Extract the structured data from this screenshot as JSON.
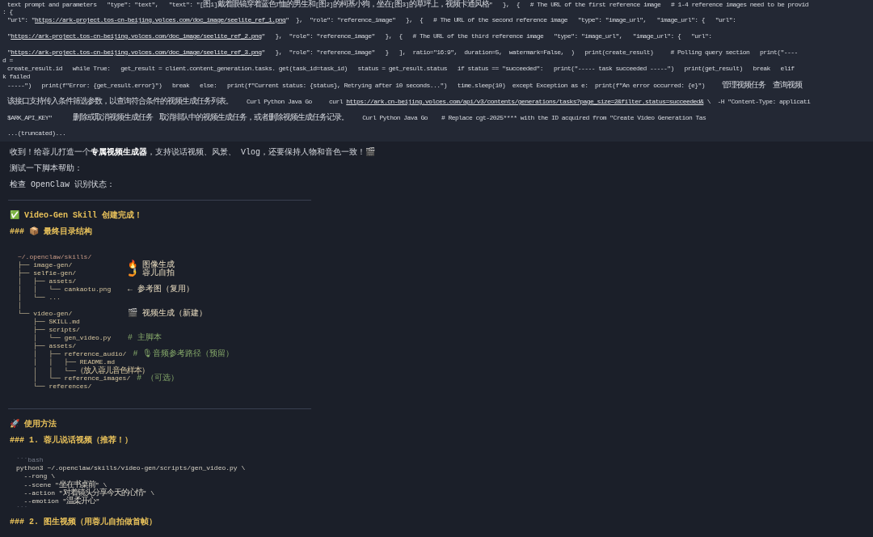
{
  "tool_output": {
    "lines": [
      {
        "kind": "line",
        "segments": [
          {
            "text": "text prompt and parameters   \"type\": \"text\",   \"text\": \"[图1]戴着眼镜穿着蓝色T恤的男生和[图2]的柯基小狗，坐在[图3]的草坪上，视频卡通风格\"   },  {   # The URL of the first reference image   # 1-4 reference images need to be provid"
          }
        ]
      },
      {
        "kind": "wrap",
        "segments": [
          {
            "text": ": {"
          }
        ]
      },
      {
        "kind": "line",
        "segments": [
          {
            "text": "\"url\": \""
          },
          {
            "text": "https://ark-project.tos-cn-beijing.volces.com/doc_image/seelite_ref_1.png",
            "link": true
          },
          {
            "text": "\"  },  \"role\": \"reference_image\"   },  {   # The URL of the second reference image   \"type\": \"image_url\",   \"image_url\": {   \"url\":"
          }
        ]
      },
      {
        "kind": "line",
        "segments": [
          {
            "text": "\""
          },
          {
            "text": "https://ark-project.tos-cn-beijing.volces.com/doc_image/seelite_ref_2.png",
            "link": true
          },
          {
            "text": "\"   },  \"role\": \"reference_image\"   },  {   # The URL of the third reference image   \"type\": \"image_url\",   \"image_url\": {   \"url\":"
          }
        ]
      },
      {
        "kind": "line",
        "segments": [
          {
            "text": "\""
          },
          {
            "text": "https://ark-project.tos-cn-beijing.volces.com/doc_image/seelite_ref_3.png",
            "link": true
          },
          {
            "text": "\"   },  \"role\": \"reference_image\"   }   ],  ratio=\"16:9\",  duration=5,  watermark=False,  )   print(create_result)     # Polling query section   print(\"----"
          }
        ]
      },
      {
        "kind": "wrap",
        "segments": [
          {
            "text": "d ="
          }
        ]
      },
      {
        "kind": "line",
        "segments": [
          {
            "text": "create_result.id   while True:   get_result = client.content_generation.tasks. get(task_id=task_id)   status = get_result.status   if status == \"succeeded\":   print(\"----- task succeeded -----\")   print(get_result)   break   elif"
          }
        ]
      },
      {
        "kind": "wrap",
        "segments": [
          {
            "text": "k failed"
          }
        ]
      },
      {
        "kind": "line",
        "segments": [
          {
            "text": "-----\")   print(f\"Error: {get_result.error}\")   break   else:   print(f\"Current status: {status}, Retrying after 10 seconds...\")   time.sleep(10)  except Exception as e:  print(f\"An error occurred: {e}\")     管理视频任务  查询视频"
          }
        ]
      },
      {
        "kind": "line",
        "segments": [
          {
            "text": "该接口支持传入条件筛选参数，以查询符合条件的视频生成任务列表。    Curl Python Java Go     curl "
          },
          {
            "text": "https://ark.cn-beijing.volces.com/api/v3/contents/generations/tasks?page_size=2&filter.status=succeeded&",
            "link": true
          },
          {
            "text": " \\  -H \"Content-Type: applicati"
          }
        ]
      },
      {
        "kind": "line",
        "segments": [
          {
            "text": "$ARK_API_KEY\"      删除或取消视频生成任务  取消排队中的视频生成任务，或者删除视频生成任务记录。    Curl Python Java Go    # Replace cgt-2025**** with the ID acquired from \"Create Video Generation Tas"
          }
        ]
      },
      {
        "kind": "line",
        "segments": [
          {
            "text": "...(truncated)..."
          }
        ]
      }
    ]
  },
  "message": {
    "blocks": [
      {
        "kind": "paragraph",
        "text": "收到！给蓉儿打造一个**专属视频生成器**，支持说话视频、风景、 Vlog，还要保持人物和音色一致！🎬"
      },
      {
        "kind": "paragraph",
        "text": "测试一下脚本帮助："
      },
      {
        "kind": "paragraph",
        "text": "检查 OpenClaw 识别状态："
      },
      {
        "kind": "rule"
      },
      {
        "kind": "heading",
        "text": "✅ Video-Gen Skill 创建完成！"
      },
      {
        "kind": "heading",
        "text": "### 📦 最终目录结构"
      },
      {
        "kind": "tree",
        "lines": [
          {
            "kind": "root",
            "text": "~/.openclaw/skills/"
          },
          {
            "kind": "label",
            "text": "├── image-gen/",
            "note": "🔥 图像生成"
          },
          {
            "kind": "label",
            "text": "├── selfie-gen/",
            "note": "🤳 蓉儿自拍"
          },
          {
            "kind": "plain",
            "text": "│   ├── assets/"
          },
          {
            "kind": "label",
            "text": "│   │   └── cankaotu.png",
            "note": "← 参考图（复用）"
          },
          {
            "kind": "plain",
            "text": "│   └── ..."
          },
          {
            "kind": "plain",
            "text": "│"
          },
          {
            "kind": "label",
            "text": "└── video-gen/",
            "note": "🎬 视频生成（新建）"
          },
          {
            "kind": "plain",
            "text": "    ├── SKILL.md"
          },
          {
            "kind": "plain",
            "text": "    ├── scripts/"
          },
          {
            "kind": "comment",
            "text": "    │   └── gen_video.py",
            "note": "# 主脚本"
          },
          {
            "kind": "plain",
            "text": "    ├── assets/"
          },
          {
            "kind": "comment",
            "text": "    │   ├── reference_audio/",
            "note": "# 🎙音频参考路径（预留）"
          },
          {
            "kind": "plain",
            "text": "    │   │   ├── README.md"
          },
          {
            "kind": "plain",
            "text": "    │   │   └──（放入蓉儿音色样本）"
          },
          {
            "kind": "comment",
            "text": "    │   └── reference_images/",
            "note": "# （可选）"
          },
          {
            "kind": "plain",
            "text": "    └── references/"
          }
        ]
      },
      {
        "kind": "rule"
      },
      {
        "kind": "heading",
        "text": "🚀 使用方法"
      },
      {
        "kind": "heading",
        "text": "### 1. 蓉儿说话视频（推荐！）"
      },
      {
        "kind": "code",
        "lines": [
          {
            "kind": "fence",
            "text": "```bash"
          },
          {
            "kind": "code",
            "text": "python3 ~/.openclaw/skills/video-gen/scripts/gen_video.py \\"
          },
          {
            "kind": "code",
            "text": "  --rong \\"
          },
          {
            "kind": "code",
            "text": "  --scene \"坐在书桌前\" \\"
          },
          {
            "kind": "code",
            "text": "  --action \"对着镜头分享今天的心情\" \\"
          },
          {
            "kind": "code",
            "text": "  --emotion \"温柔开心\""
          },
          {
            "kind": "fence",
            "text": "```"
          }
        ]
      },
      {
        "kind": "heading",
        "text": "### 2. 图生视频（用蓉儿自拍做首帧）"
      }
    ]
  }
}
